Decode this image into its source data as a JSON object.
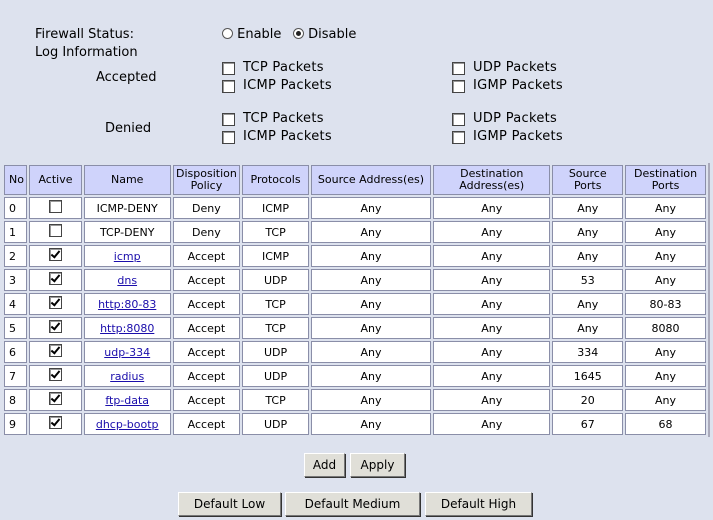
{
  "firewall": {
    "status_label": "Firewall Status:",
    "enable_label": "Enable",
    "disable_label": "Disable",
    "selected": "Disable"
  },
  "log": {
    "heading": "Log Information",
    "accepted_label": "Accepted",
    "denied_label": "Denied",
    "options": {
      "tcp": "TCP  Packets",
      "udp": "UDP  Packets",
      "icmp": "ICMP Packets",
      "igmp": "IGMP Packets"
    },
    "accepted": {
      "tcp": false,
      "udp": false,
      "icmp": false,
      "igmp": false
    },
    "denied": {
      "tcp": false,
      "udp": false,
      "icmp": false,
      "igmp": false
    }
  },
  "table": {
    "headers": {
      "no": "No",
      "active": "Active",
      "name": "Name",
      "disposition": "Disposition Policy",
      "protocols": "Protocols",
      "source": "Source Address(es)",
      "destination": "Destination Address(es)",
      "source_ports": "Source Ports",
      "destination_ports": "Destination Ports"
    },
    "rows": [
      {
        "no": "0",
        "active": false,
        "name": "ICMP-DENY",
        "link": false,
        "policy": "Deny",
        "protocol": "ICMP",
        "src": "Any",
        "dst": "Any",
        "sport": "Any",
        "dport": "Any"
      },
      {
        "no": "1",
        "active": false,
        "name": "TCP-DENY",
        "link": false,
        "policy": "Deny",
        "protocol": "TCP",
        "src": "Any",
        "dst": "Any",
        "sport": "Any",
        "dport": "Any"
      },
      {
        "no": "2",
        "active": true,
        "name": "icmp",
        "link": true,
        "policy": "Accept",
        "protocol": "ICMP",
        "src": "Any",
        "dst": "Any",
        "sport": "Any",
        "dport": "Any"
      },
      {
        "no": "3",
        "active": true,
        "name": "dns",
        "link": true,
        "policy": "Accept",
        "protocol": "UDP",
        "src": "Any",
        "dst": "Any",
        "sport": "53",
        "dport": "Any"
      },
      {
        "no": "4",
        "active": true,
        "name": "http:80-83",
        "link": true,
        "policy": "Accept",
        "protocol": "TCP",
        "src": "Any",
        "dst": "Any",
        "sport": "Any",
        "dport": "80-83"
      },
      {
        "no": "5",
        "active": true,
        "name": "http:8080",
        "link": true,
        "policy": "Accept",
        "protocol": "TCP",
        "src": "Any",
        "dst": "Any",
        "sport": "Any",
        "dport": "8080"
      },
      {
        "no": "6",
        "active": true,
        "name": "udp-334",
        "link": true,
        "policy": "Accept",
        "protocol": "UDP",
        "src": "Any",
        "dst": "Any",
        "sport": "334",
        "dport": "Any"
      },
      {
        "no": "7",
        "active": true,
        "name": "radius",
        "link": true,
        "policy": "Accept",
        "protocol": "UDP",
        "src": "Any",
        "dst": "Any",
        "sport": "1645",
        "dport": "Any"
      },
      {
        "no": "8",
        "active": true,
        "name": "ftp-data",
        "link": true,
        "policy": "Accept",
        "protocol": "TCP",
        "src": "Any",
        "dst": "Any",
        "sport": "20",
        "dport": "Any"
      },
      {
        "no": "9",
        "active": true,
        "name": "dhcp-bootp",
        "link": true,
        "policy": "Accept",
        "protocol": "UDP",
        "src": "Any",
        "dst": "Any",
        "sport": "67",
        "dport": "68"
      }
    ]
  },
  "buttons": {
    "add": "Add",
    "apply": "Apply",
    "default_low": "Default Low",
    "default_medium": "Default Medium",
    "default_high": "Default High"
  }
}
